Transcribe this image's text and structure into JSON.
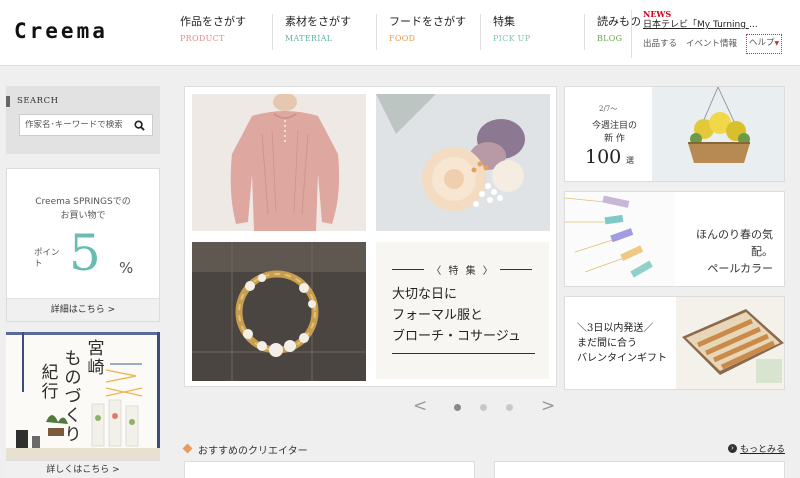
{
  "header": {
    "logo": "Creema",
    "nav": [
      {
        "ja": "作品をさがす",
        "en": "PRODUCT",
        "color": "#e48a8a"
      },
      {
        "ja": "素材をさがす",
        "en": "MATERIAL",
        "color": "#5fb3a5"
      },
      {
        "ja": "フードをさがす",
        "en": "FOOD",
        "color": "#e89b4f"
      },
      {
        "ja": "特集",
        "en": "PICK UP",
        "color": "#7fc3b6"
      },
      {
        "ja": "読みもの",
        "en": "BLOG",
        "color": "#6aa84f"
      }
    ],
    "news_label": "NEWS",
    "news_text": "日本テレビ「My Turning Po…",
    "sublinks": [
      "出品する",
      "イベント情報",
      "ヘルプ"
    ]
  },
  "search": {
    "title": "SEARCH",
    "placeholder": "作家名･キーワードで検索",
    "icon": "search-icon"
  },
  "points": {
    "line1": "Creema SPRINGSでの",
    "line2": "お買い物で",
    "label": "ポイント",
    "value": "5",
    "unit": "%",
    "more": "詳細はこちら >"
  },
  "miyazaki": {
    "title_col1": "宮崎",
    "title_col2": "ものづくり",
    "title_col3": "紀行",
    "more": "詳しくはこちら >"
  },
  "feature": {
    "kicker": "〈 特 集 〉",
    "title": "大切な日に\nフォーマル服と\nブローチ・コサージュ"
  },
  "carousel": {
    "prev": "<",
    "next": ">",
    "active_index": 0,
    "count": 3
  },
  "recommend": {
    "title": "おすすめのクリエイター",
    "more": "もっとみる"
  },
  "banners": {
    "b1": {
      "date": "2/7〜",
      "line1": "今週注目の",
      "line2": "新 作",
      "num": "100",
      "unit": "選"
    },
    "b2": {
      "line1": "ほんのり春の気配。",
      "line2": "ペールカラー"
    },
    "b3": {
      "text": "＼3日以内発送／\nまだ間に合う\nバレンタインギフト"
    }
  },
  "colors": {
    "accent_teal": "#6bbcb0",
    "news_red": "#d0021b",
    "diamond_orange": "#e89b5a"
  }
}
